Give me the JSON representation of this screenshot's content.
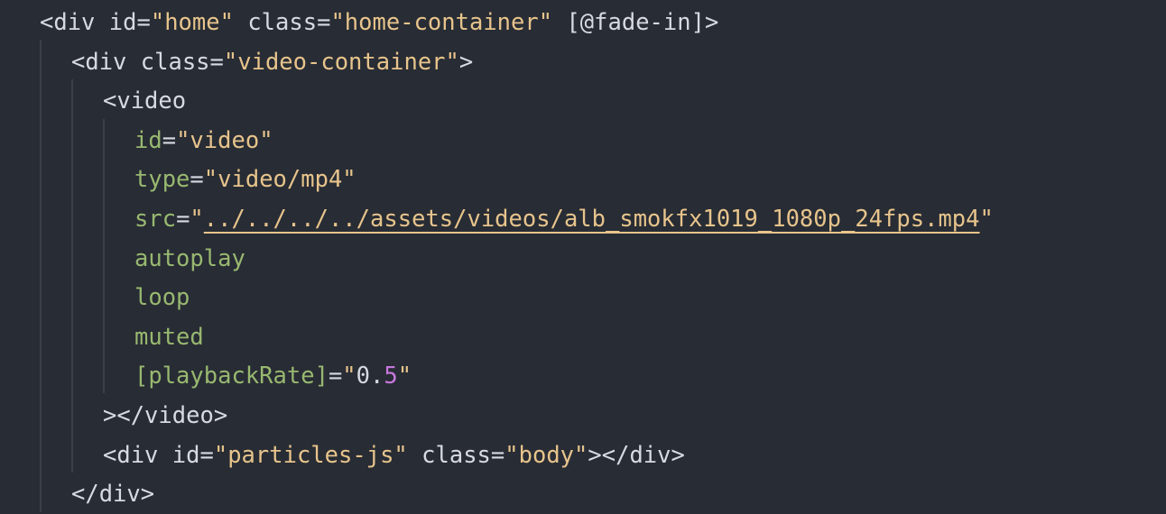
{
  "editor": {
    "colors": {
      "background": "#282c34",
      "text": "#d7dae0",
      "attribute": "#98b870",
      "string": "#e7c48c",
      "number": "#c678dd",
      "indent_guide": "#3b3f47"
    },
    "lines": [
      {
        "indent": 0,
        "tokens": [
          {
            "t": "<div ",
            "c": "c-fg"
          },
          {
            "t": "id",
            "c": "c-fg"
          },
          {
            "t": "=",
            "c": "c-fg"
          },
          {
            "t": "\"home\"",
            "c": "c-str"
          },
          {
            "t": " class",
            "c": "c-fg"
          },
          {
            "t": "=",
            "c": "c-fg"
          },
          {
            "t": "\"home-container\"",
            "c": "c-str"
          },
          {
            "t": " [@fade-in]>",
            "c": "c-fg"
          }
        ]
      },
      {
        "indent": 1,
        "tokens": [
          {
            "t": "<div ",
            "c": "c-fg"
          },
          {
            "t": "class",
            "c": "c-fg"
          },
          {
            "t": "=",
            "c": "c-fg"
          },
          {
            "t": "\"video-container\"",
            "c": "c-str"
          },
          {
            "t": ">",
            "c": "c-fg"
          }
        ]
      },
      {
        "indent": 2,
        "tokens": [
          {
            "t": "<video",
            "c": "c-fg"
          }
        ]
      },
      {
        "indent": 3,
        "tokens": [
          {
            "t": "id",
            "c": "c-attr"
          },
          {
            "t": "=",
            "c": "c-fg"
          },
          {
            "t": "\"video\"",
            "c": "c-str"
          }
        ]
      },
      {
        "indent": 3,
        "tokens": [
          {
            "t": "type",
            "c": "c-attr"
          },
          {
            "t": "=",
            "c": "c-fg"
          },
          {
            "t": "\"video/mp4\"",
            "c": "c-str"
          }
        ]
      },
      {
        "indent": 3,
        "tokens": [
          {
            "t": "src",
            "c": "c-attr"
          },
          {
            "t": "=",
            "c": "c-fg"
          },
          {
            "t": "\"",
            "c": "c-str"
          },
          {
            "t": "../../../../assets/videos/alb_smokfx1019_1080p_24fps.mp4",
            "c": "c-link"
          },
          {
            "t": "\"",
            "c": "c-str"
          }
        ]
      },
      {
        "indent": 3,
        "tokens": [
          {
            "t": "autoplay",
            "c": "c-attr"
          }
        ]
      },
      {
        "indent": 3,
        "tokens": [
          {
            "t": "loop",
            "c": "c-attr"
          }
        ]
      },
      {
        "indent": 3,
        "tokens": [
          {
            "t": "muted",
            "c": "c-attr"
          }
        ]
      },
      {
        "indent": 3,
        "tokens": [
          {
            "t": "[playbackRate]",
            "c": "c-attr"
          },
          {
            "t": "=",
            "c": "c-fg"
          },
          {
            "t": "\"",
            "c": "c-str"
          },
          {
            "t": "0.",
            "c": "c-fg"
          },
          {
            "t": "5",
            "c": "c-num"
          },
          {
            "t": "\"",
            "c": "c-str"
          }
        ]
      },
      {
        "indent": 2,
        "tokens": [
          {
            "t": "></video>",
            "c": "c-fg"
          }
        ]
      },
      {
        "indent": 2,
        "tokens": [
          {
            "t": "<div ",
            "c": "c-fg"
          },
          {
            "t": "id",
            "c": "c-fg"
          },
          {
            "t": "=",
            "c": "c-fg"
          },
          {
            "t": "\"particles-js\"",
            "c": "c-str"
          },
          {
            "t": " class",
            "c": "c-fg"
          },
          {
            "t": "=",
            "c": "c-fg"
          },
          {
            "t": "\"body\"",
            "c": "c-str"
          },
          {
            "t": "></div>",
            "c": "c-fg"
          }
        ]
      },
      {
        "indent": 1,
        "tokens": [
          {
            "t": "</div>",
            "c": "c-fg"
          }
        ]
      }
    ]
  }
}
